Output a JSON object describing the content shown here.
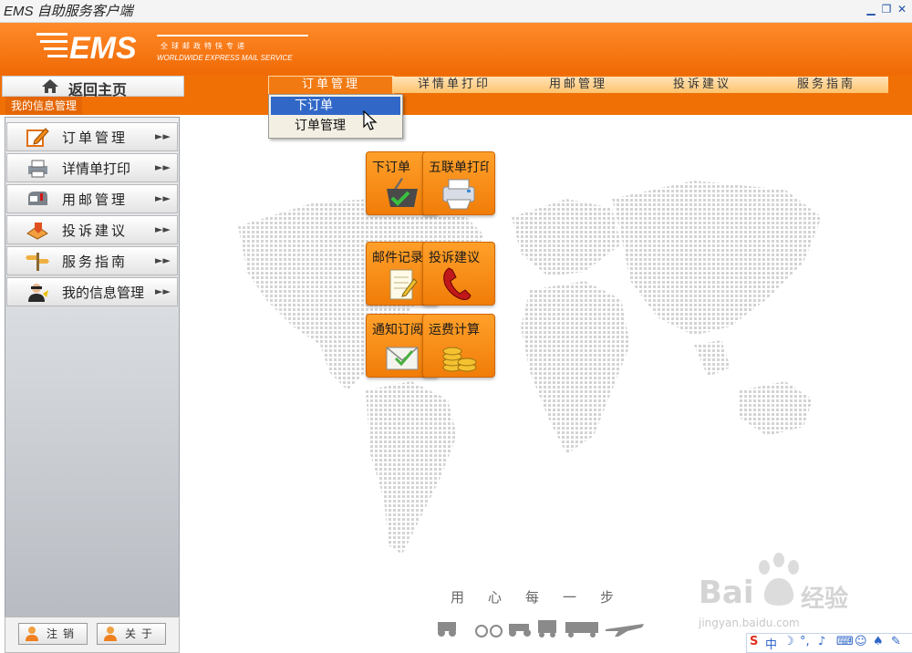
{
  "window": {
    "title": "EMS 自助服务客户端",
    "controls": [
      "minimize",
      "restore",
      "close"
    ]
  },
  "logo": {
    "brand": "EMS",
    "line1": "全球邮政特快专递",
    "line2": "WORLDWIDE EXPRESS MAIL SERVICE"
  },
  "nav": {
    "home": "返回主页",
    "tabs": [
      {
        "label": "订单管理",
        "active": true
      },
      {
        "label": "详情单打印",
        "active": false
      },
      {
        "label": "用邮管理",
        "active": false
      },
      {
        "label": "投诉建议",
        "active": false
      },
      {
        "label": "服务指南",
        "active": false
      }
    ],
    "section": "我的信息管理"
  },
  "dropdown": {
    "items": [
      "下订单",
      "订单管理"
    ],
    "selected": "下订单"
  },
  "sidebar": {
    "items": [
      {
        "label": "订单管理",
        "icon": "edit-icon"
      },
      {
        "label": "详情单打印",
        "icon": "printer-icon"
      },
      {
        "label": "用邮管理",
        "icon": "mailbox-icon"
      },
      {
        "label": "投诉建议",
        "icon": "complaint-icon"
      },
      {
        "label": "服务指南",
        "icon": "signpost-icon"
      },
      {
        "label": "我的信息管理",
        "icon": "user-icon"
      }
    ],
    "logout": "注销",
    "about": "关于"
  },
  "tiles": [
    {
      "label": "下订单",
      "icon": "basket-icon"
    },
    {
      "label": "五联单打印",
      "icon": "printer-icon"
    },
    {
      "label": "邮件记录",
      "icon": "notepad-icon"
    },
    {
      "label": "投诉建议",
      "icon": "telephone-icon"
    },
    {
      "label": "通知订阅",
      "icon": "envelope-icon"
    },
    {
      "label": "运费计算",
      "icon": "coins-icon"
    }
  ],
  "slogan": "用心每一步",
  "watermark": {
    "brand": "Bai",
    "brand2": "经验",
    "url": "jingyan.baidu.com"
  },
  "tray": {
    "ime": "中"
  },
  "colors": {
    "accent": "#f07006",
    "selection": "#3168c8",
    "tile": "#f68f1a"
  }
}
